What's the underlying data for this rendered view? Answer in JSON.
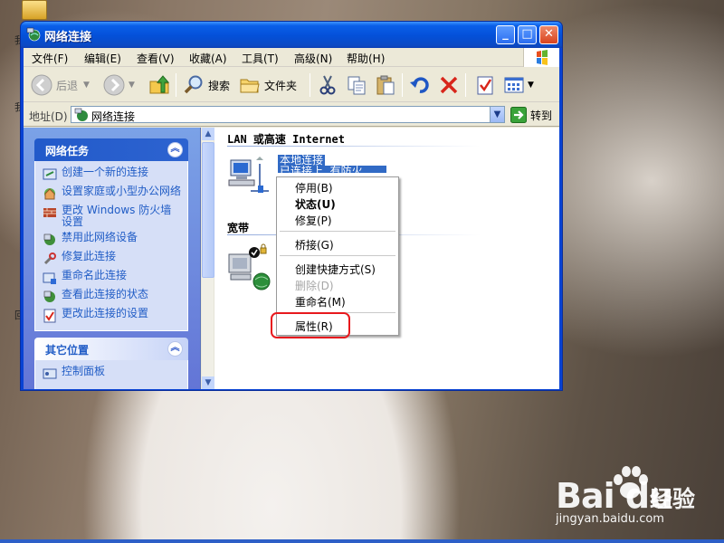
{
  "window": {
    "title": "网络连接",
    "buttons": {
      "minimize": "_",
      "maximize": "□",
      "close": "✕"
    }
  },
  "menubar": {
    "items": [
      "文件(F)",
      "编辑(E)",
      "查看(V)",
      "收藏(A)",
      "工具(T)",
      "高级(N)",
      "帮助(H)"
    ]
  },
  "toolbar": {
    "back": "后退",
    "search": "搜索",
    "folders": "文件夹"
  },
  "address": {
    "label": "地址(D)",
    "value": "网络连接",
    "go": "转到"
  },
  "network_tasks": {
    "title": "网络任务",
    "items": [
      {
        "label": "创建一个新的连接",
        "icon": "new-connection-icon"
      },
      {
        "label": "设置家庭或小型办公网络",
        "icon": "home-network-icon"
      },
      {
        "label": "更改 Windows 防火墙设置",
        "icon": "firewall-icon"
      },
      {
        "label": "禁用此网络设备",
        "icon": "disable-device-icon"
      },
      {
        "label": "修复此连接",
        "icon": "repair-icon"
      },
      {
        "label": "重命名此连接",
        "icon": "rename-icon"
      },
      {
        "label": "查看此连接的状态",
        "icon": "status-icon"
      },
      {
        "label": "更改此连接的设置",
        "icon": "settings-icon"
      }
    ]
  },
  "other_places": {
    "title": "其它位置",
    "items": [
      {
        "label": "控制面板",
        "icon": "control-panel-icon"
      }
    ]
  },
  "content": {
    "groups": {
      "lan": "LAN 或高速 Internet",
      "broadband": "宽带"
    },
    "connections": {
      "local": {
        "name": "本地连接",
        "status_partial": "已连接上, 有防火"
      }
    }
  },
  "context_menu": {
    "items": {
      "disable": "停用(B)",
      "status": "状态(U)",
      "repair": "修复(P)",
      "bridge": "桥接(G)",
      "shortcut": "创建快捷方式(S)",
      "delete": "删除(D)",
      "rename": "重命名(M)",
      "properties": "属性(R)"
    },
    "highlighted": "properties",
    "highlight_color": "#e8191d"
  },
  "watermark": {
    "brand": "Bai du",
    "brand_cn": "经验",
    "url": "jingyan.baidu.com"
  },
  "colors": {
    "titlebar": "#0450d8",
    "task_link": "#215dc6",
    "selection": "#316ac5"
  }
}
